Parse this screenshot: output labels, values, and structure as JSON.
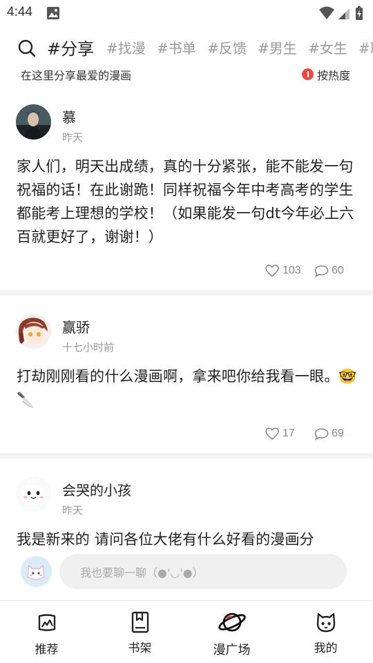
{
  "status_bar": {
    "time": "4:44"
  },
  "tabs": [
    {
      "label": "#分享",
      "active": true
    },
    {
      "label": "#找漫",
      "active": false
    },
    {
      "label": "#书单",
      "active": false
    },
    {
      "label": "#反馈",
      "active": false
    },
    {
      "label": "#男生",
      "active": false
    },
    {
      "label": "#女生",
      "active": false
    },
    {
      "label": "#耶",
      "active": false
    }
  ],
  "sub_header": {
    "description": "在这里分享最爱的漫画",
    "sort_label": "按热度"
  },
  "posts": [
    {
      "username": "慕",
      "time": "昨天",
      "content": "家人们，明天出成绩，真的十分紧张，能不能发一句祝福的话！在此谢跪！同样祝福今年中考高考的学生都能考上理想的学校！（如果能发一句dt今年必上六百就更好了，谢谢！）",
      "likes": "103",
      "comments": "60"
    },
    {
      "username": "赢骄",
      "time": "十七小时前",
      "content": "打劫刚刚看的什么漫画啊，拿来吧你给我看一眼。🤓🔪",
      "likes": "17",
      "comments": "69"
    },
    {
      "username": "会哭的小孩",
      "time": "昨天",
      "content": "我是新来的 请问各位大佬有什么好看的漫画分"
    }
  ],
  "comment_bar": {
    "placeholder": "我也要聊一聊（●'◡'●）"
  },
  "bottom_nav": [
    {
      "label": "推荐",
      "icon": "recommend-icon"
    },
    {
      "label": "书架",
      "icon": "bookshelf-icon"
    },
    {
      "label": "漫广场",
      "icon": "planet-icon",
      "active": true
    },
    {
      "label": "我的",
      "icon": "profile-cat-icon"
    }
  ],
  "colors": {
    "accent_red": "#e84a3f",
    "muted": "#999999",
    "divider": "#f2f2f2",
    "input_bg": "#f0f0f0"
  }
}
